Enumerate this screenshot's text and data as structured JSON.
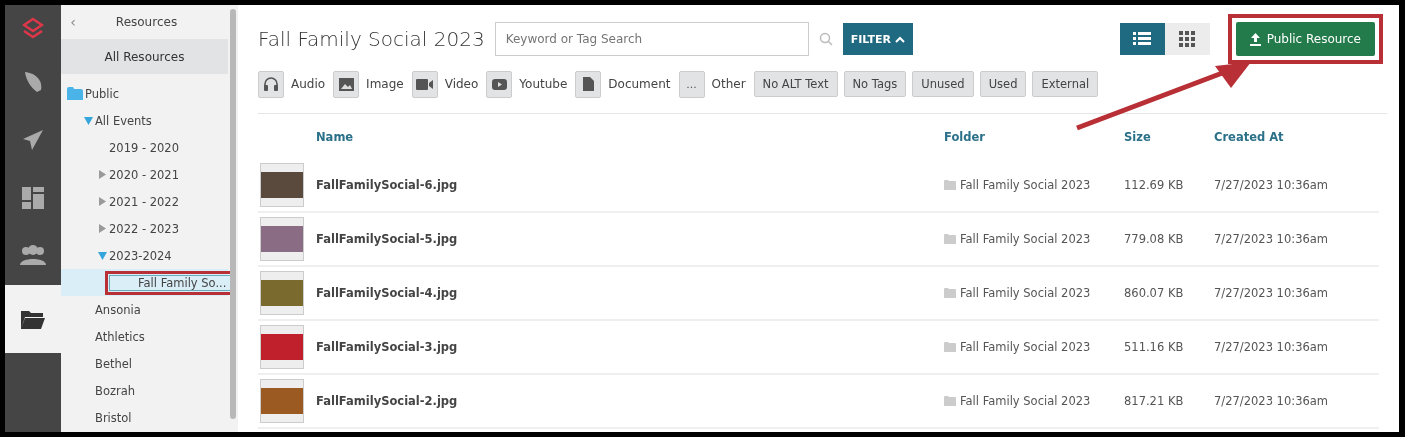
{
  "rail": [
    {
      "kind": "logo",
      "selected": false
    },
    {
      "kind": "feather",
      "selected": false
    },
    {
      "kind": "plane",
      "selected": false
    },
    {
      "kind": "dashboard",
      "selected": false
    },
    {
      "kind": "people",
      "selected": false
    },
    {
      "kind": "folder",
      "selected": true
    }
  ],
  "sidebar": {
    "back": "‹",
    "title": "Resources",
    "all_resources": "All Resources",
    "tree": [
      {
        "label": "Public",
        "selected": false,
        "highlighted": false,
        "children": [
          {
            "label": "All Events",
            "expanded": true,
            "selected": false,
            "highlighted": false,
            "children": [
              {
                "label": "2019 - 2020",
                "selected": false,
                "highlighted": false
              },
              {
                "label": "2020 - 2021",
                "expanded": false,
                "selected": false,
                "highlighted": false
              },
              {
                "label": "2021 - 2022",
                "expanded": false,
                "selected": false,
                "highlighted": false
              },
              {
                "label": "2022 - 2023",
                "expanded": false,
                "selected": false,
                "highlighted": false
              },
              {
                "label": "2023-2024",
                "expanded": true,
                "selected": false,
                "highlighted": false,
                "children": [
                  {
                    "label": "Fall Family So...",
                    "selected": true,
                    "highlighted": true
                  }
                ]
              }
            ]
          },
          {
            "label": "Ansonia",
            "selected": false,
            "highlighted": false
          },
          {
            "label": "Athletics",
            "selected": false,
            "highlighted": false
          },
          {
            "label": "Bethel",
            "selected": false,
            "highlighted": false
          },
          {
            "label": "Bozrah",
            "selected": false,
            "highlighted": false
          },
          {
            "label": "Bristol",
            "selected": false,
            "highlighted": false
          }
        ]
      }
    ]
  },
  "header": {
    "title": "Fall Family Social 2023",
    "search": {
      "placeholder": "Keyword or Tag Search"
    },
    "filter_button": "FILTER",
    "views": [
      {
        "kind": "list",
        "selected": true
      },
      {
        "kind": "grid",
        "selected": false
      }
    ],
    "upload_button": {
      "label": "Public Resource",
      "highlighted": true
    }
  },
  "type_filters": [
    {
      "kind": "audio",
      "label": "Audio"
    },
    {
      "kind": "image",
      "label": "Image"
    },
    {
      "kind": "video",
      "label": "Video"
    },
    {
      "kind": "youtube",
      "label": "Youtube"
    },
    {
      "kind": "document",
      "label": "Document"
    },
    {
      "kind": "other",
      "icon_text": "...",
      "label": "Other"
    }
  ],
  "tag_filters": [
    "No ALT Text",
    "No Tags",
    "Unused",
    "Used",
    "External"
  ],
  "table": {
    "columns": [
      "Name",
      "Folder",
      "Size",
      "Created At"
    ],
    "rows": [
      {
        "name": "FallFamilySocial-6.jpg",
        "folder": "Fall Family Social 2023",
        "size": "112.69 KB",
        "created": "7/27/2023 10:36am",
        "color": "#5a4a3e"
      },
      {
        "name": "FallFamilySocial-5.jpg",
        "folder": "Fall Family Social 2023",
        "size": "779.08 KB",
        "created": "7/27/2023 10:36am",
        "color": "#8a6c84"
      },
      {
        "name": "FallFamilySocial-4.jpg",
        "folder": "Fall Family Social 2023",
        "size": "860.07 KB",
        "created": "7/27/2023 10:36am",
        "color": "#7a6a2e"
      },
      {
        "name": "FallFamilySocial-3.jpg",
        "folder": "Fall Family Social 2023",
        "size": "511.16 KB",
        "created": "7/27/2023 10:36am",
        "color": "#c0202c"
      },
      {
        "name": "FallFamilySocial-2.jpg",
        "folder": "Fall Family Social 2023",
        "size": "817.21 KB",
        "created": "7/27/2023 10:36am",
        "color": "#9a5a22"
      }
    ]
  }
}
